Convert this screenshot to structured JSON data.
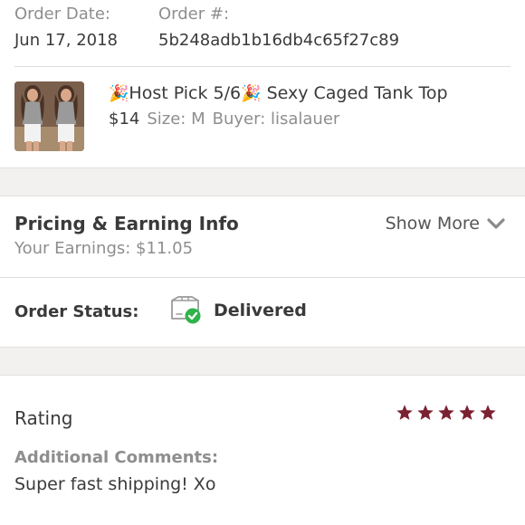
{
  "order": {
    "date_label": "Order Date:",
    "date_value": "Jun 17, 2018",
    "number_label": "Order #:",
    "number_value": "5b248adb1b16db4c65f27c89"
  },
  "item": {
    "party_emoji": "🎉",
    "title_mid": "Host Pick 5/6",
    "title_tail": " Sexy Caged Tank Top",
    "price": "$14",
    "size": "Size: M",
    "buyer": "Buyer: lisalauer",
    "thumbnail_icon": "product-photo"
  },
  "pricing": {
    "title": "Pricing & Earning Info",
    "earnings": "Your Earnings: $11.05",
    "show_more": "Show More",
    "chevron_icon": "chevron-down-icon"
  },
  "status": {
    "label": "Order Status:",
    "value": "Delivered",
    "icon": "package-delivered-icon",
    "check_color": "#2fb34a"
  },
  "rating": {
    "title": "Rating",
    "stars": 5,
    "star_color": "#7b2131",
    "comments_label": "Additional Comments:",
    "comments_text": "Super fast shipping! Xo"
  }
}
